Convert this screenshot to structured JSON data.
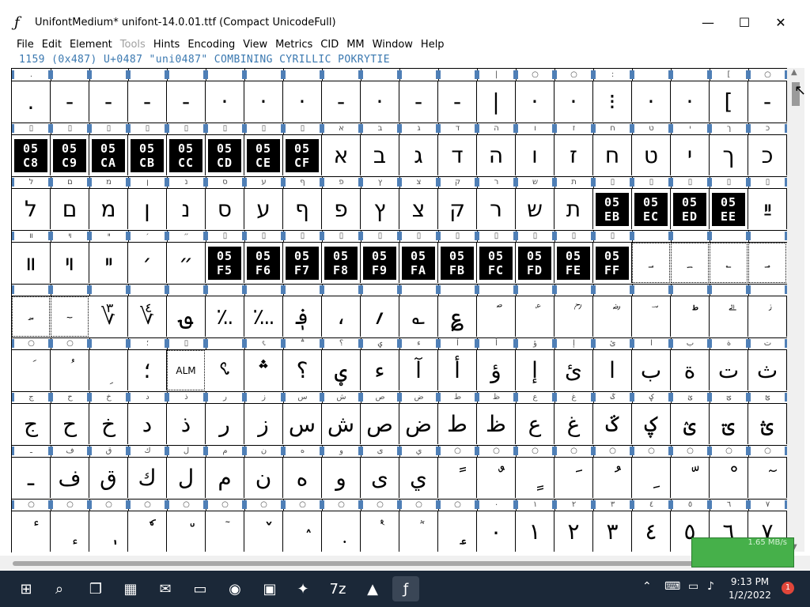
{
  "window": {
    "title": "UnifontMedium*  unifont-14.0.01.ttf (Compact UnicodeFull)",
    "app_icon": "ƒ",
    "minimize": "—",
    "maximize": "☐",
    "close": "✕"
  },
  "menu": [
    "File",
    "Edit",
    "Element",
    "Tools",
    "Hints",
    "Encoding",
    "View",
    "Metrics",
    "CID",
    "MM",
    "Window",
    "Help"
  ],
  "menu_disabled": [
    "Tools"
  ],
  "info_line": "1159 (0x487) U+0487 \"uni0487\" COMBINING CYRILLIC POKRYTIE",
  "grid": {
    "rows": [
      {
        "labels": [
          ".",
          "",
          "",
          "",
          "",
          "",
          "",
          "",
          "",
          "",
          "",
          "",
          "|",
          "○",
          "○",
          ":",
          "",
          "",
          "[",
          "○"
        ],
        "glyphs": [
          ".",
          "-",
          "-",
          "-",
          "-",
          "·",
          "·",
          "·",
          "-",
          "·",
          "-",
          "-",
          "|",
          "·",
          "·",
          "⁝",
          "·",
          "·",
          "[",
          "-"
        ]
      },
      {
        "labels": [
          "▯",
          "▯",
          "▯",
          "▯",
          "▯",
          "▯",
          "▯",
          "▯",
          "א",
          "ב",
          "ג",
          "ד",
          "ה",
          "ו",
          "ז",
          "ח",
          "ט",
          "י",
          "ך",
          "כ"
        ],
        "glyphs": [
          {
            "box": [
              "05",
              "C8"
            ]
          },
          {
            "box": [
              "05",
              "C9"
            ]
          },
          {
            "box": [
              "05",
              "CA"
            ]
          },
          {
            "box": [
              "05",
              "CB"
            ]
          },
          {
            "box": [
              "05",
              "CC"
            ]
          },
          {
            "box": [
              "05",
              "CD"
            ]
          },
          {
            "box": [
              "05",
              "CE"
            ]
          },
          {
            "box": [
              "05",
              "CF"
            ]
          },
          "א",
          "ב",
          "ג",
          "ד",
          "ה",
          "ו",
          "ז",
          "ח",
          "ט",
          "י",
          "ך",
          "כ"
        ]
      },
      {
        "labels": [
          "ל",
          "ם",
          "מ",
          "ן",
          "נ",
          "ס",
          "ע",
          "ף",
          "פ",
          "ץ",
          "צ",
          "ק",
          "ר",
          "ש",
          "ת",
          "▯",
          "▯",
          "▯",
          "▯",
          "▯"
        ],
        "glyphs": [
          "ל",
          "ם",
          "מ",
          "ן",
          "נ",
          "ס",
          "ע",
          "ף",
          "פ",
          "ץ",
          "צ",
          "ק",
          "ר",
          "ש",
          "ת",
          {
            "box": [
              "05",
              "EB"
            ]
          },
          {
            "box": [
              "05",
              "EC"
            ]
          },
          {
            "box": [
              "05",
              "ED"
            ]
          },
          {
            "box": [
              "05",
              "EE"
            ]
          },
          "ײַ"
        ]
      },
      {
        "labels": [
          "װ",
          "ױ",
          "ײ",
          "׳",
          "״",
          "▯",
          "▯",
          "▯",
          "▯",
          "▯",
          "▯",
          "▯",
          "▯",
          "▯",
          "▯",
          "▯",
          "",
          "",
          "",
          ""
        ],
        "glyphs": [
          "װ",
          "ױ",
          "ײ",
          "׳",
          "״",
          {
            "box": [
              "05",
              "F5"
            ]
          },
          {
            "box": [
              "05",
              "F6"
            ]
          },
          {
            "box": [
              "05",
              "F7"
            ]
          },
          {
            "box": [
              "05",
              "F8"
            ]
          },
          {
            "box": [
              "05",
              "F9"
            ]
          },
          {
            "box": [
              "05",
              "FA"
            ]
          },
          {
            "box": [
              "05",
              "FB"
            ]
          },
          {
            "box": [
              "05",
              "FC"
            ]
          },
          {
            "box": [
              "05",
              "FD"
            ]
          },
          {
            "box": [
              "05",
              "FE"
            ]
          },
          {
            "box": [
              "05",
              "FF"
            ]
          },
          {
            "dotted": "؀"
          },
          {
            "dotted": "؁"
          },
          {
            "dotted": "؂"
          },
          {
            "dotted": "؃"
          }
        ]
      },
      {
        "labels": [
          "",
          "",
          "",
          "",
          "",
          "",
          "",
          "",
          "",
          "",
          "",
          "",
          "",
          "",
          "",
          "",
          "",
          "",
          "",
          ""
        ],
        "glyphs": [
          {
            "dotted": "؄"
          },
          {
            "dotted": "؅"
          },
          "؆",
          "؇",
          "؈",
          "؉",
          "؊",
          "؋",
          "،",
          "؍",
          "؎",
          "؏",
          "ؐ",
          "ؑ",
          "ؒ",
          "ؓ",
          "ؔ",
          "ؕ",
          "ؖ",
          "ؗ"
        ]
      },
      {
        "labels": [
          "○",
          "○",
          "",
          "؛",
          "▯",
          "",
          "؝",
          "؞",
          "؟",
          "ؠ",
          "ء",
          "آ",
          "أ",
          "ؤ",
          "إ",
          "ئ",
          "ا",
          "ب",
          "ة",
          "ت"
        ],
        "glyphs": [
          "ؘ",
          "ؙ",
          "ؚ",
          "؛",
          {
            "dotted": "ALM"
          },
          "؝",
          "؞",
          "؟",
          "ؠ",
          "ء",
          "آ",
          "أ",
          "ؤ",
          "إ",
          "ئ",
          "ا",
          "ب",
          "ة",
          "ت",
          "ث"
        ]
      },
      {
        "labels": [
          "ج",
          "ح",
          "خ",
          "د",
          "ذ",
          "ر",
          "ز",
          "س",
          "ش",
          "ص",
          "ض",
          "ط",
          "ظ",
          "ع",
          "غ",
          "ػ",
          "ؼ",
          "ؽ",
          "ؾ",
          "ؿ"
        ],
        "glyphs": [
          "ج",
          "ح",
          "خ",
          "د",
          "ذ",
          "ر",
          "ز",
          "س",
          "ش",
          "ص",
          "ض",
          "ط",
          "ظ",
          "ع",
          "غ",
          "ػ",
          "ؼ",
          "ؽ",
          "ؾ",
          "ؿ"
        ]
      },
      {
        "labels": [
          "ـ",
          "ف",
          "ق",
          "ك",
          "ل",
          "م",
          "ن",
          "ه",
          "و",
          "ى",
          "ي",
          "○",
          "○",
          "○",
          "○",
          "○",
          "○",
          "○",
          "○",
          "○"
        ],
        "glyphs": [
          "ـ",
          "ف",
          "ق",
          "ك",
          "ل",
          "م",
          "ن",
          "ه",
          "و",
          "ى",
          "ي",
          "ً",
          "ٌ",
          "ٍ",
          "َ",
          "ُ",
          "ِ",
          "ّ",
          "ْ",
          "ٓ"
        ]
      },
      {
        "labels": [
          "○",
          "○",
          "○",
          "○",
          "○",
          "○",
          "○",
          "○",
          "○",
          "○",
          "○",
          "○",
          "٠",
          "١",
          "٢",
          "٣",
          "٤",
          "٥",
          "٦",
          "٧"
        ],
        "glyphs": [
          "ٔ",
          "ٕ",
          "ٖ",
          "ٗ",
          "٘",
          "ٙ",
          "ٚ",
          "ٛ",
          "ٜ",
          "ٝ",
          "ٞ",
          "ٟ",
          "٠",
          "١",
          "٢",
          "٣",
          "٤",
          "٥",
          "٦",
          "٧"
        ]
      }
    ]
  },
  "net_meter": "1.65 MB/s",
  "taskbar": {
    "icons": [
      "windows-start-icon",
      "search-icon",
      "task-view-icon",
      "widgets-icon",
      "teams-chat-icon",
      "file-explorer-icon",
      "chrome-icon",
      "store-icon",
      "app-icon",
      "7zip-icon",
      "inkscape-icon",
      "fontforge-icon"
    ],
    "clock_time": "9:13 PM",
    "clock_date": "1/2/2022",
    "notification_count": "1"
  }
}
